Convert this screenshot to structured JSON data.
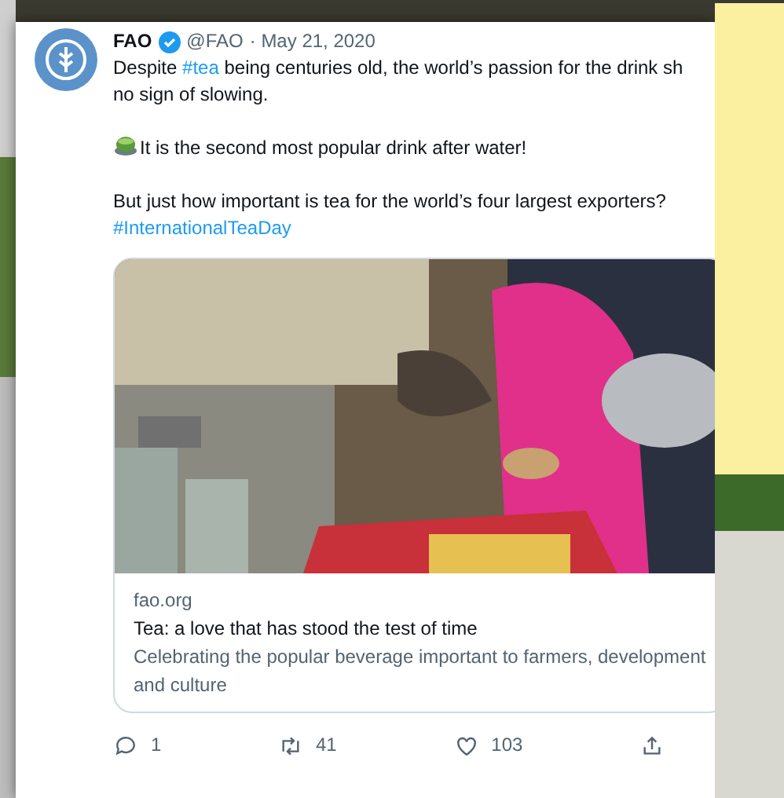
{
  "tweet": {
    "author": "FAO",
    "verified": true,
    "handle": "@FAO",
    "date": "· May 21, 2020",
    "paragraphs": [
      {
        "lines": [
          [
            {
              "kind": "text",
              "text": "Despite "
            },
            {
              "kind": "hashtag",
              "text": "#tea"
            },
            {
              "kind": "text",
              "text": " being centuries old, the world’s passion for the drink sh"
            }
          ],
          [
            {
              "kind": "text",
              "text": "no sign of slowing."
            }
          ]
        ]
      },
      {
        "lines": [
          [
            {
              "kind": "emoji"
            },
            {
              "kind": "text",
              "text": "It is the second most popular drink after water!"
            }
          ]
        ]
      },
      {
        "lines": [
          [
            {
              "kind": "text",
              "text": "But just how important is tea for the world’s four largest exporters?"
            }
          ],
          [
            {
              "kind": "hashtag",
              "text": "#InternationalTeaDay"
            }
          ]
        ]
      }
    ],
    "card": {
      "kind": "picture",
      "domain": "fao.org",
      "title": "Tea: a love that has stood the test of time",
      "description": "Celebrating the popular beverage important to farmers, development and culture"
    },
    "actions": [
      {
        "kind": "reply",
        "count": "1"
      },
      {
        "kind": "retweet",
        "count": "41"
      },
      {
        "kind": "like",
        "count": "103"
      },
      {
        "kind": "share"
      }
    ]
  }
}
